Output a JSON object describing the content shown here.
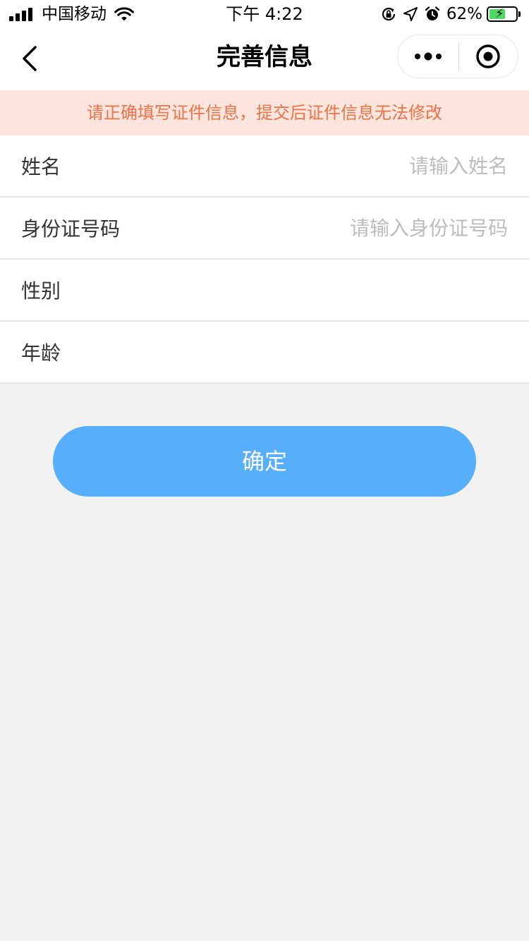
{
  "status_bar": {
    "carrier": "中国移动",
    "time": "下午 4:22",
    "battery": "62%",
    "battery_level": 0.62,
    "icons": [
      "signal-icon",
      "wifi-icon",
      "orientation-lock-icon",
      "location-icon",
      "alarm-icon",
      "battery-icon"
    ]
  },
  "nav": {
    "title": "完善信息",
    "back_icon": "chevron-left-icon",
    "more_icon": "more-dots-icon",
    "close_icon": "target-circle-icon"
  },
  "notice": {
    "text": "请正确填写证件信息，提交后证件信息无法修改"
  },
  "form": {
    "fields": [
      {
        "label": "姓名",
        "value": "",
        "placeholder": "请输入姓名"
      },
      {
        "label": "身份证号码",
        "value": "",
        "placeholder": "请输入身份证号码"
      },
      {
        "label": "性别",
        "value": "",
        "placeholder": ""
      },
      {
        "label": "年龄",
        "value": "",
        "placeholder": ""
      }
    ]
  },
  "submit": {
    "label": "确定"
  },
  "colors": {
    "notice_bg": "#fde4dc",
    "notice_text": "#e8744a",
    "button": "#57aefb",
    "page_bg": "#f2f2f2",
    "battery_fill": "#4cd964"
  }
}
